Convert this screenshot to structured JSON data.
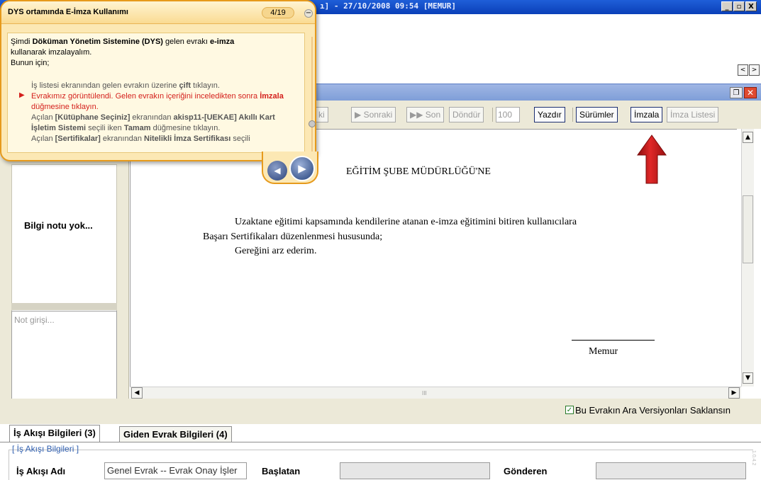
{
  "window": {
    "title": "ı] - 27/10/2008 09:54 [MEMUR]",
    "min": "_",
    "max": "▫",
    "close": "X"
  },
  "nav": {
    "prev": "<",
    "next": ">"
  },
  "toolbar": {
    "prev_partial": "ki",
    "next": "▶ Sonraki",
    "last": "▶▶ Son",
    "rotate": "Döndür",
    "zoom": "100",
    "print": "Yazdır",
    "versions": "Sürümler",
    "sign": "İmzala",
    "sign_list": "İmza Listesi"
  },
  "left_panel": {
    "info": "Bilgi notu yok...",
    "note_placeholder": "Not girişi..."
  },
  "document": {
    "heading": "EĞİTİM ŞUBE MÜDÜRLÜĞÜ'NE",
    "p1": "Uzaktane eğitimi kapsamında kendilerine atanan e-imza eğitimini bitiren kullanıcılara",
    "p2": "Başarı Sertifikaları düzenlenmesi hususunda;",
    "p3": "Gereğini arz ederim.",
    "signature": "Memur"
  },
  "checkbox": {
    "label": "Bu Evrakın Ara Versiyonları Saklansın",
    "checked": true
  },
  "tabs": [
    {
      "label": "İş Akışı Bilgileri (3)",
      "active": true
    },
    {
      "label": "Giden Evrak Bilgileri (4)",
      "active": false
    }
  ],
  "workflow": {
    "legend": "[ İş Akışı Bilgileri ]",
    "name_label": "İş Akışı Adı",
    "name_value": "Genel Evrak -- Evrak Onay İşler",
    "starter_label": "Başlatan",
    "starter_value": "",
    "sender_label": "Gönderen",
    "sender_value": "",
    "version_text": "1.0.4.2"
  },
  "tutorial": {
    "title": "DYS ortamında E-İmza Kullanımı",
    "counter": "4/19",
    "minimize": "−",
    "intro_1a": "Şimdi ",
    "intro_1b": "Döküman Yönetim Sistemine (DYS)",
    "intro_1c": " gelen evrakı ",
    "intro_1d": "e-imza",
    "intro_2": "kullanarak imzalayalım.",
    "intro_3": "Bunun için;",
    "step_1a": "İş listesi ekranından gelen evrakın üzerine ",
    "step_1b": "çift",
    "step_1c": " tıklayın.",
    "step_2a": "Evrakımız görüntülendi. Gelen evrakın içeriğini inceledikten sonra ",
    "step_2b": "İmzala",
    "step_2c": " düğmesine tıklayın.",
    "step_3a": "Açılan ",
    "step_3b": "[Kütüphane Seçiniz]",
    "step_3c": " ekranından ",
    "step_3d": "akisp11-[UEKAE] Akıllı Kart İşletim Sistemi",
    "step_3e": " seçili iken ",
    "step_3f": "Tamam",
    "step_3g": " düğmesine tıklayın.",
    "step_4a": "Açılan ",
    "step_4b": "[Sertifikalar]",
    "step_4c": " ekranından ",
    "step_4d": "Nitelikli İmza Sertifikası",
    "step_4e": " seçili",
    "prev": "◀",
    "next": "▶"
  },
  "colors": {
    "tutorial_bg": "#fce8b4",
    "tutorial_border": "#e69a1c",
    "highlight_red": "#d4201c",
    "titlebar_blue": "#0b3fb8"
  }
}
